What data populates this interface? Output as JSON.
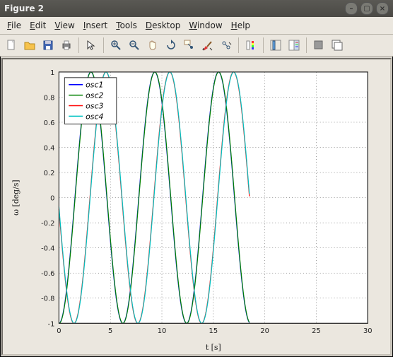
{
  "window_title": "Figure 2",
  "menu": [
    "File",
    "Edit",
    "View",
    "Insert",
    "Tools",
    "Desktop",
    "Window",
    "Help"
  ],
  "toolbar": [
    {
      "name": "new-figure-icon",
      "glyph": "newdoc"
    },
    {
      "name": "open-icon",
      "glyph": "folder"
    },
    {
      "name": "save-icon",
      "glyph": "floppy"
    },
    {
      "name": "print-icon",
      "glyph": "printer"
    },
    {
      "name": "sep"
    },
    {
      "name": "pointer-icon",
      "glyph": "pointer"
    },
    {
      "name": "sep"
    },
    {
      "name": "zoom-in-icon",
      "glyph": "zoomin"
    },
    {
      "name": "zoom-out-icon",
      "glyph": "zoomout"
    },
    {
      "name": "pan-icon",
      "glyph": "hand"
    },
    {
      "name": "rotate-icon",
      "glyph": "rotate"
    },
    {
      "name": "data-cursor-icon",
      "glyph": "datacursor"
    },
    {
      "name": "brush-icon",
      "glyph": "brush"
    },
    {
      "name": "link-icon",
      "glyph": "link"
    },
    {
      "name": "sep"
    },
    {
      "name": "colorbar-icon",
      "glyph": "colorbar"
    },
    {
      "name": "sep"
    },
    {
      "name": "legend-icon",
      "glyph": "legend"
    },
    {
      "name": "panel-icon",
      "glyph": "panel"
    },
    {
      "name": "sep"
    },
    {
      "name": "hide-icon",
      "glyph": "hide"
    },
    {
      "name": "show-icon",
      "glyph": "show"
    }
  ],
  "chart_data": {
    "type": "line",
    "title": "",
    "xlabel": "t [s]",
    "ylabel": "ω [deg/s]",
    "xlim": [
      0,
      30
    ],
    "ylim": [
      -1,
      1
    ],
    "xticks": [
      0,
      5,
      10,
      15,
      20,
      25,
      30
    ],
    "yticks": [
      -1,
      -0.8,
      -0.6,
      -0.4,
      -0.2,
      0,
      0.2,
      0.4,
      0.6,
      0.8,
      1
    ],
    "grid": true,
    "legend": {
      "position": "upper-left",
      "entries": [
        "osc1",
        "osc2",
        "osc3",
        "osc4"
      ]
    },
    "colors": {
      "osc1": "#0000ff",
      "osc2": "#008000",
      "osc3": "#ff0000",
      "osc4": "#00c2c2"
    },
    "x_range_data": [
      0,
      18.5
    ],
    "period": 6.2,
    "amplitude": 1.0,
    "series": [
      {
        "name": "osc1",
        "phase": 0.0
      },
      {
        "name": "osc2",
        "phase": 0.02
      },
      {
        "name": "osc3",
        "phase": 1.48
      },
      {
        "name": "osc4",
        "phase": 1.5
      }
    ]
  }
}
